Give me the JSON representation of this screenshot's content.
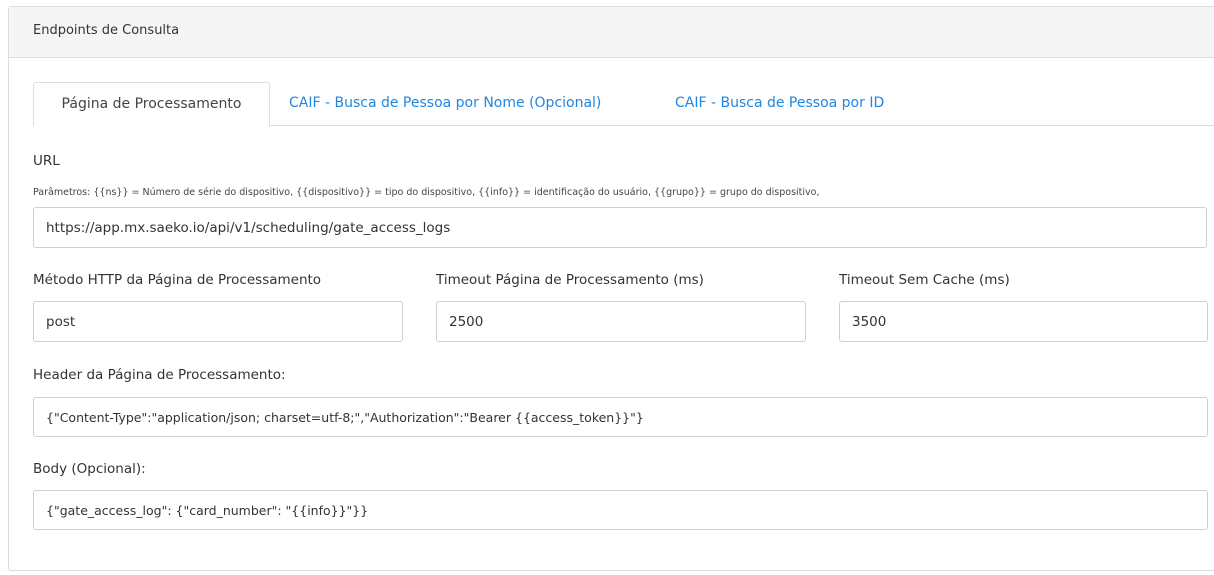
{
  "panel": {
    "title": "Endpoints de Consulta"
  },
  "tabs": [
    {
      "label": "Página de Processamento",
      "active": true
    },
    {
      "label": "CAIF - Busca de Pessoa por Nome (Opcional)",
      "active": false
    },
    {
      "label": "CAIF - Busca de Pessoa por ID",
      "active": false
    }
  ],
  "url": {
    "label": "URL",
    "params_help": "Parâmetros: {{ns}} = Número de série do dispositivo, {{dispositivo}} = tipo do dispositivo, {{info}} = identificação do usuário, {{grupo}} = grupo do dispositivo,",
    "value": "https://app.mx.saeko.io/api/v1/scheduling/gate_access_logs"
  },
  "http_method": {
    "label": "Método HTTP da Página de Processamento",
    "value": "post"
  },
  "timeout": {
    "label": "Timeout Página de Processamento (ms)",
    "value": "2500"
  },
  "timeout_no_cache": {
    "label": "Timeout Sem Cache (ms)",
    "value": "3500"
  },
  "header": {
    "label": "Header da Página de Processamento:",
    "value": "{\"Content-Type\":\"application/json; charset=utf-8;\",\"Authorization\":\"Bearer {{access_token}}\"}"
  },
  "body": {
    "label": "Body (Opcional):",
    "value": "{\"gate_access_log\": {\"card_number\": \"{{info}}\"}}"
  },
  "colors": {
    "link": "#1f86e0",
    "heading_bg": "#f5f5f5",
    "border": "#dcdcdc"
  }
}
